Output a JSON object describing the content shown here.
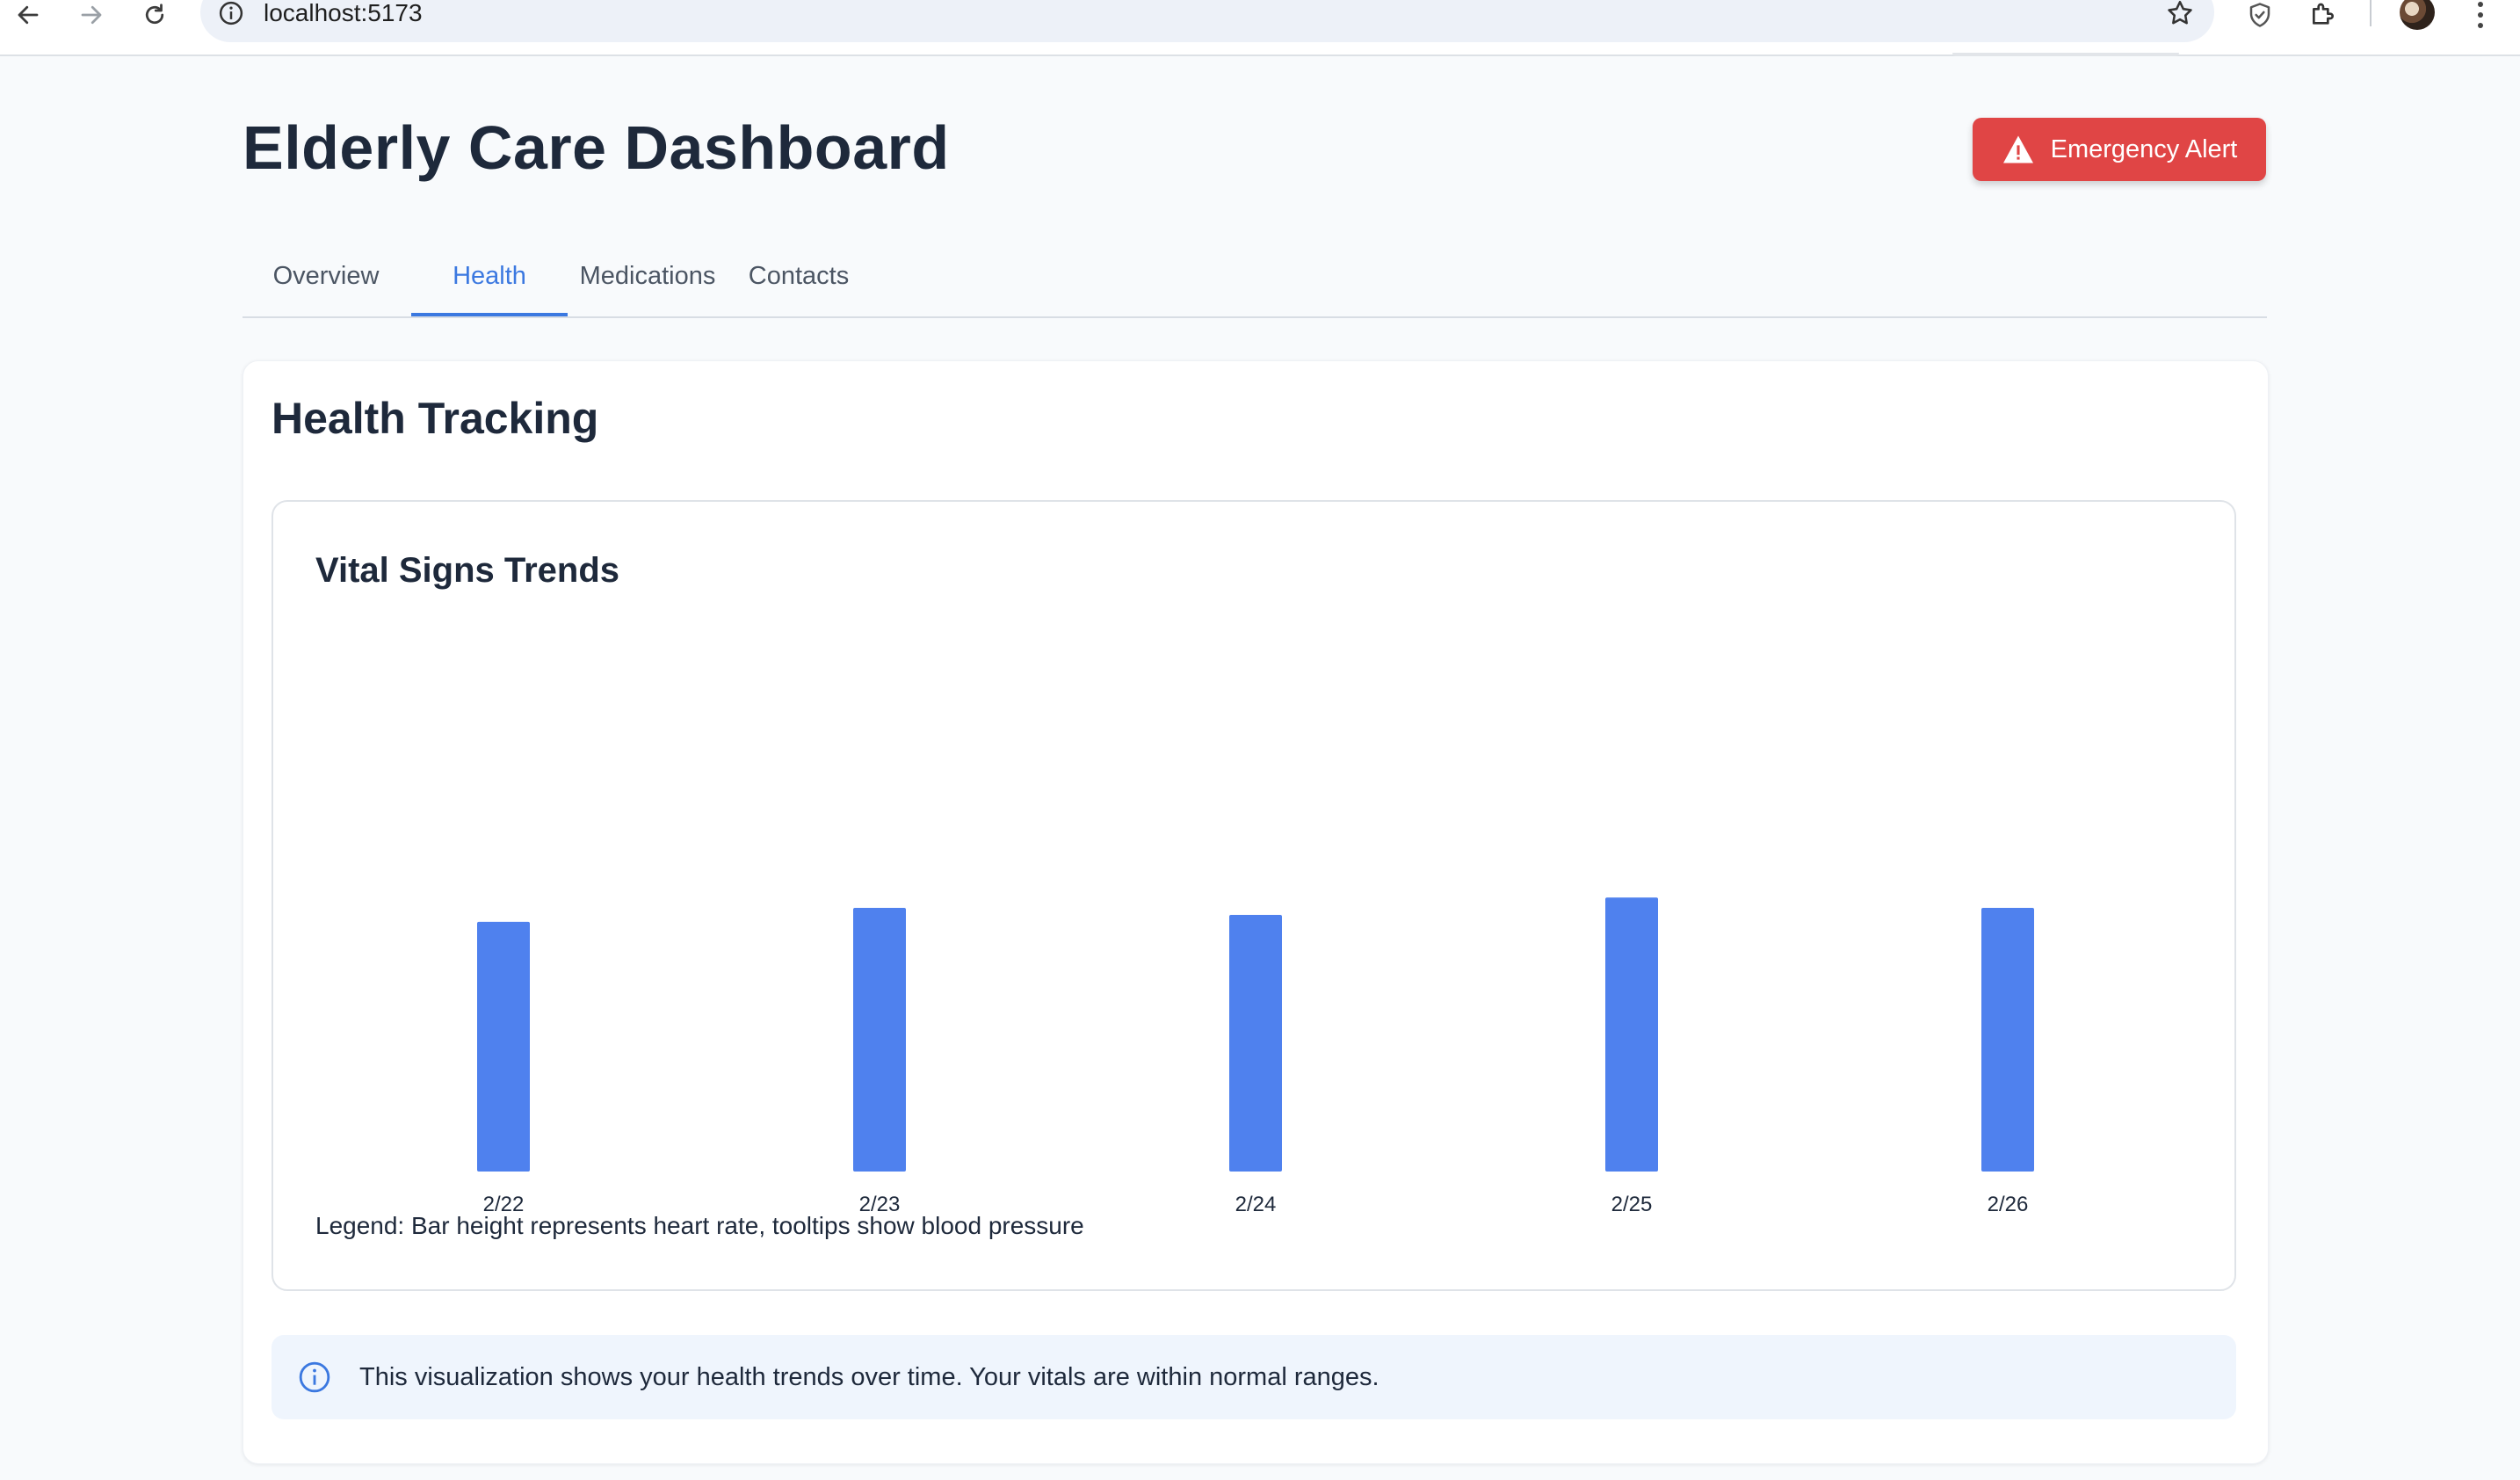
{
  "browser": {
    "url": "localhost:5173",
    "icons": [
      "back-icon",
      "forward-icon",
      "reload-icon",
      "info-icon",
      "star-icon",
      "shield-icon",
      "extensions-icon",
      "profile-avatar",
      "menu-icon"
    ]
  },
  "header": {
    "title": "Elderly Care Dashboard",
    "emergency_label": "Emergency Alert"
  },
  "tabs": [
    {
      "label": "Overview",
      "active": false
    },
    {
      "label": "Health",
      "active": true
    },
    {
      "label": "Medications",
      "active": false
    },
    {
      "label": "Contacts",
      "active": false
    }
  ],
  "section": {
    "title": "Health Tracking",
    "chart_title": "Vital Signs Trends",
    "legend": "Legend: Bar height represents heart rate, tooltips show blood pressure",
    "info": "This visualization shows your health trends over time. Your vitals are within normal ranges."
  },
  "colors": {
    "accent": "#3b78e0",
    "bar": "#4f81ee",
    "danger": "#e04545",
    "info_bg": "#eff5fd"
  },
  "chart_data": {
    "type": "bar",
    "title": "Vital Signs Trends",
    "categories": [
      "2/22",
      "2/23",
      "2/24",
      "2/25",
      "2/26"
    ],
    "values": [
      72,
      76,
      74,
      79,
      76
    ],
    "ylim": [
      0,
      150
    ],
    "xlabel": "",
    "ylabel": "",
    "grid": false
  }
}
